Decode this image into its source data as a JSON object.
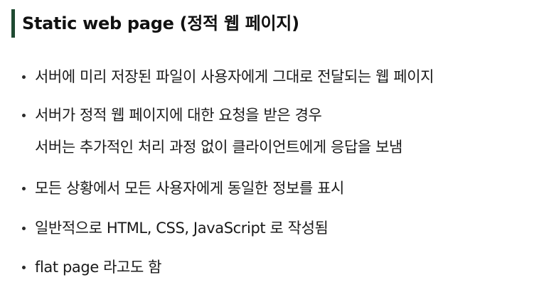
{
  "slide": {
    "title": "Static web page (정적 웹 페이지)",
    "bullets": [
      {
        "lines": [
          "서버에 미리 저장된 파일이 사용자에게 그대로 전달되는 웹 페이지"
        ]
      },
      {
        "lines": [
          "서버가 정적 웹 페이지에 대한 요청을 받은 경우",
          "서버는 추가적인 처리 과정 없이 클라이언트에게 응답을 보냄"
        ]
      },
      {
        "lines": [
          "모든 상황에서 모든 사용자에게 동일한 정보를 표시"
        ]
      },
      {
        "lines": [
          "일반적으로 HTML, CSS, JavaScript 로 작성됨"
        ]
      },
      {
        "lines": [
          "flat page 라고도 함"
        ]
      }
    ],
    "colors": {
      "accent_bar": "#1f4a32",
      "text": "#1a1a1a"
    }
  }
}
